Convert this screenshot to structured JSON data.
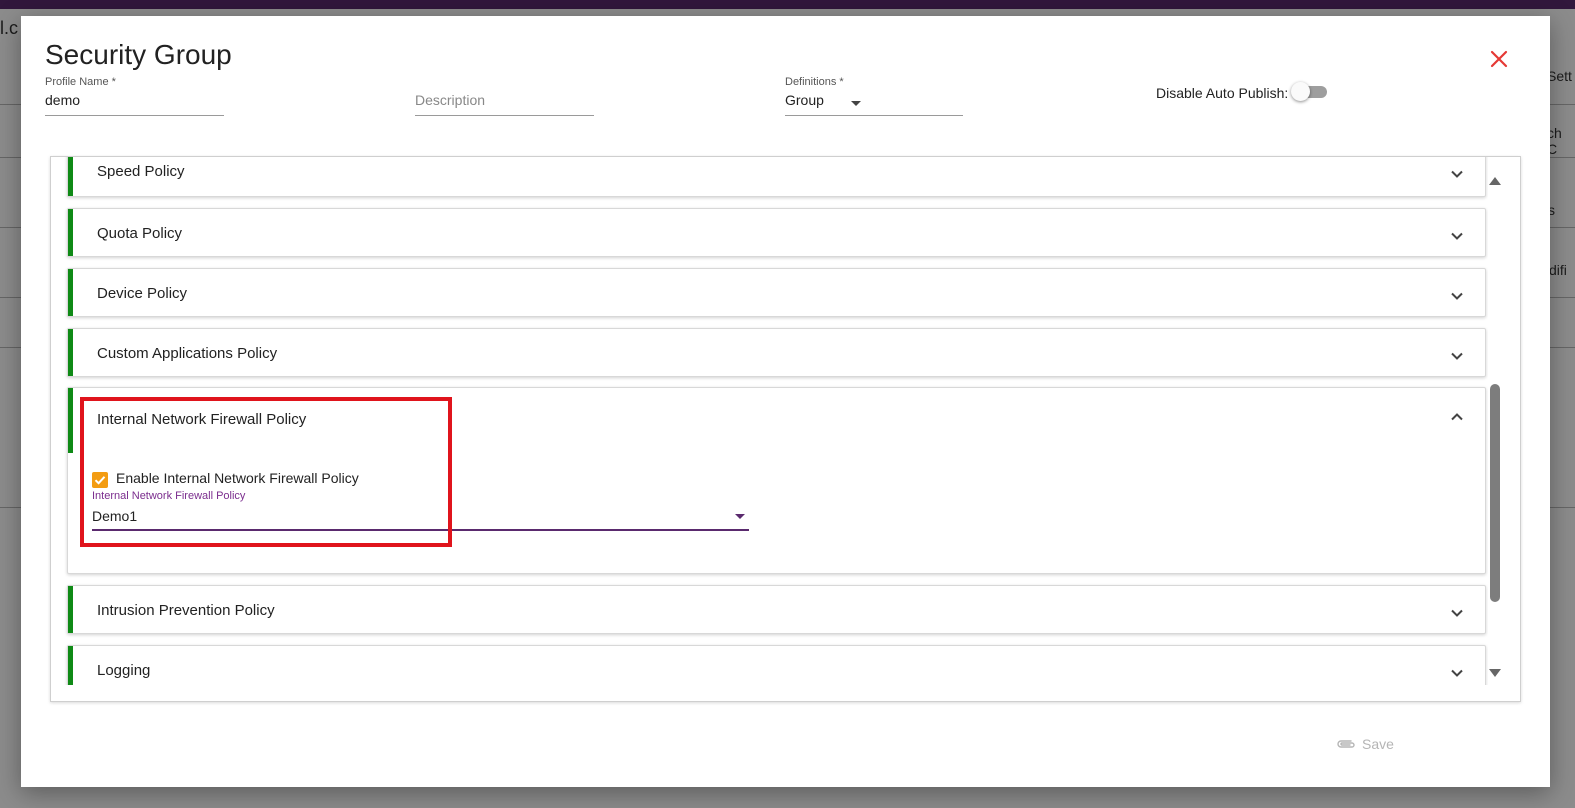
{
  "background": {
    "left_partial_text": "l.c",
    "right_partial_texts": [
      "Sett",
      "ch C",
      "s",
      "difi"
    ]
  },
  "dialog": {
    "title": "Security Group",
    "close_icon": "close-icon",
    "fields": {
      "profile_name": {
        "label": "Profile Name *",
        "value": "demo"
      },
      "description": {
        "placeholder": "Description",
        "value": ""
      },
      "definitions": {
        "label": "Definitions *",
        "value": "Group"
      }
    },
    "auto_publish": {
      "label": "Disable Auto Publish:",
      "enabled": false
    },
    "accordion": [
      {
        "title": "Speed Policy",
        "expanded": false
      },
      {
        "title": "Quota Policy",
        "expanded": false
      },
      {
        "title": "Device Policy",
        "expanded": false
      },
      {
        "title": "Custom Applications Policy",
        "expanded": false
      },
      {
        "title": "Internal Network Firewall Policy",
        "expanded": true,
        "checkbox_label": "Enable Internal Network Firewall Policy",
        "checkbox_checked": true,
        "select_label": "Internal Network Firewall Policy",
        "select_value": "Demo1"
      },
      {
        "title": "Intrusion Prevention Policy",
        "expanded": false
      },
      {
        "title": "Logging",
        "expanded": false
      }
    ],
    "save_label": "Save",
    "colors": {
      "accent_green": "#0f8a16",
      "close_red": "#e53935",
      "checkbox_orange": "#f39c12",
      "purple": "#7b2d8e",
      "highlight_red": "#e0141c"
    }
  }
}
